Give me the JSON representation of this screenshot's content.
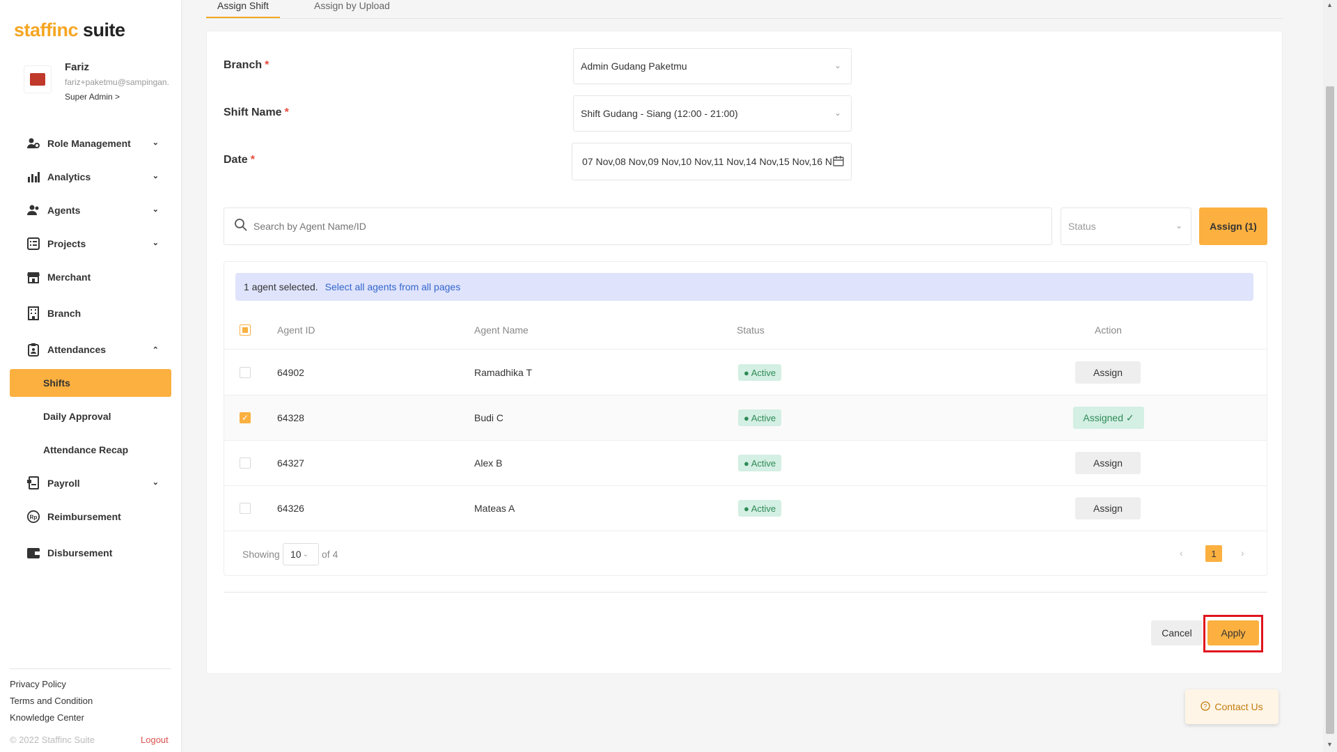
{
  "brand": {
    "logo_staff": "staff",
    "logo_inc": "inc",
    "logo_suite": " suite",
    "accent": "#fbb040"
  },
  "profile": {
    "name": "Fariz",
    "email": "fariz+paketmu@sampingan.",
    "role": "Super Admin >"
  },
  "nav": {
    "role_management": "Role Management",
    "analytics": "Analytics",
    "agents": "Agents",
    "projects": "Projects",
    "merchant": "Merchant",
    "branch": "Branch",
    "attendances": "Attendances",
    "shifts": "Shifts",
    "daily_approval": "Daily Approval",
    "attendance_recap": "Attendance Recap",
    "payroll": "Payroll",
    "reimbursement": "Reimbursement",
    "disbursement": "Disbursement"
  },
  "footer": {
    "privacy": "Privacy Policy",
    "terms": "Terms and Condition",
    "knowledge": "Knowledge Center",
    "copyright": "© 2022 Staffinc Suite",
    "logout": "Logout"
  },
  "tabs": {
    "assign_shift": "Assign Shift",
    "assign_upload": "Assign by Upload"
  },
  "form": {
    "branch_label": "Branch",
    "branch_value": "Admin Gudang Paketmu",
    "shift_label": "Shift Name",
    "shift_value": "Shift Gudang - Siang (12:00 - 21:00)",
    "date_label": "Date",
    "date_value": "07 Nov,08 Nov,09 Nov,10 Nov,11 Nov,14 Nov,15 Nov,16 N",
    "required": "*"
  },
  "toolbar": {
    "search_placeholder": "Search by Agent Name/ID",
    "status_placeholder": "Status",
    "assign_label": "Assign (1)"
  },
  "selection": {
    "text": "1 agent selected.",
    "link": "Select all agents from all pages"
  },
  "table": {
    "headers": {
      "agent_id": "Agent ID",
      "agent_name": "Agent Name",
      "status": "Status",
      "action": "Action"
    },
    "rows": [
      {
        "id": "64902",
        "name": "Ramadhika T",
        "status": "● Active",
        "action": "Assign"
      },
      {
        "id": "64328",
        "name": "Budi C",
        "status": "● Active",
        "action": "Assigned ✓"
      },
      {
        "id": "64327",
        "name": "Alex B",
        "status": "● Active",
        "action": "Assign"
      },
      {
        "id": "64326",
        "name": "Mateas A",
        "status": "● Active",
        "action": "Assign"
      }
    ]
  },
  "pagination": {
    "showing": "Showing",
    "page_size": "10",
    "of_total": "of 4",
    "current_page": "1"
  },
  "actions": {
    "cancel": "Cancel",
    "apply": "Apply"
  },
  "contact": "Contact Us"
}
